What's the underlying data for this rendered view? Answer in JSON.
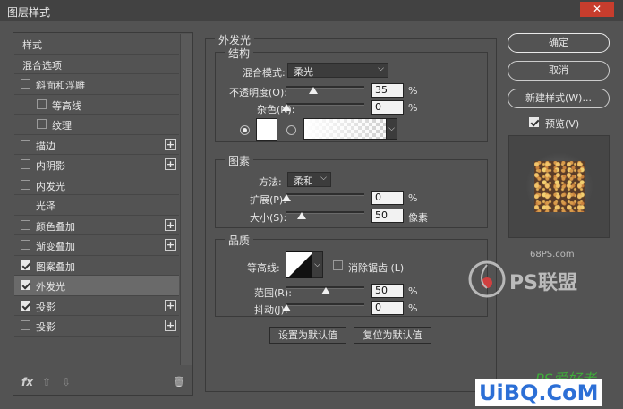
{
  "window": {
    "title": "图层样式",
    "close_label": "✕"
  },
  "left": {
    "items": [
      {
        "label": "样式",
        "checkbox": false,
        "checked": false,
        "indent": 0,
        "plus": false
      },
      {
        "label": "混合选项",
        "checkbox": false,
        "checked": false,
        "indent": 0,
        "plus": false
      },
      {
        "label": "斜面和浮雕",
        "checkbox": true,
        "checked": false,
        "indent": 0,
        "plus": false
      },
      {
        "label": "等高线",
        "checkbox": true,
        "checked": false,
        "indent": 1,
        "plus": false
      },
      {
        "label": "纹理",
        "checkbox": true,
        "checked": false,
        "indent": 1,
        "plus": false
      },
      {
        "label": "描边",
        "checkbox": true,
        "checked": false,
        "indent": 0,
        "plus": true
      },
      {
        "label": "内阴影",
        "checkbox": true,
        "checked": false,
        "indent": 0,
        "plus": true
      },
      {
        "label": "内发光",
        "checkbox": true,
        "checked": false,
        "indent": 0,
        "plus": false
      },
      {
        "label": "光泽",
        "checkbox": true,
        "checked": false,
        "indent": 0,
        "plus": false
      },
      {
        "label": "颜色叠加",
        "checkbox": true,
        "checked": false,
        "indent": 0,
        "plus": true
      },
      {
        "label": "渐变叠加",
        "checkbox": true,
        "checked": false,
        "indent": 0,
        "plus": true
      },
      {
        "label": "图案叠加",
        "checkbox": true,
        "checked": true,
        "indent": 0,
        "plus": false
      },
      {
        "label": "外发光",
        "checkbox": true,
        "checked": true,
        "indent": 0,
        "plus": false,
        "selected": true
      },
      {
        "label": "投影",
        "checkbox": true,
        "checked": true,
        "indent": 0,
        "plus": true
      },
      {
        "label": "投影",
        "checkbox": true,
        "checked": false,
        "indent": 0,
        "plus": true
      }
    ],
    "toolbar": {
      "fx": "fx",
      "up": "⇧",
      "down": "⇩",
      "trash": "🗑"
    }
  },
  "outer_glow": {
    "title": "外发光",
    "structure": {
      "title": "结构",
      "blend_mode_label": "混合模式:",
      "blend_mode_value": "柔光",
      "opacity_label": "不透明度(O):",
      "opacity_value": "35",
      "opacity_unit": "%",
      "noise_label": "杂色(N):",
      "noise_value": "0",
      "noise_unit": "%"
    },
    "elements": {
      "title": "图素",
      "technique_label": "方法:",
      "technique_value": "柔和",
      "spread_label": "扩展(P):",
      "spread_value": "0",
      "spread_unit": "%",
      "size_label": "大小(S):",
      "size_value": "50",
      "size_unit": "像素"
    },
    "quality": {
      "title": "品质",
      "contour_label": "等高线:",
      "antialias_label": "消除锯齿 (L)",
      "range_label": "范围(R):",
      "range_value": "50",
      "range_unit": "%",
      "jitter_label": "抖动(J):",
      "jitter_value": "0",
      "jitter_unit": "%"
    },
    "make_default_label": "设置为默认值",
    "reset_default_label": "复位为默认值"
  },
  "slider_levels": {
    "opacity": 0.35,
    "noise": 0,
    "spread": 0,
    "size": 0.2,
    "range": 0.5,
    "jitter": 0
  },
  "right": {
    "ok_label": "确定",
    "cancel_label": "取消",
    "new_style_label": "新建样式(W)...",
    "preview_label": "预览(V)",
    "preview_checked": true
  },
  "watermarks": {
    "site": "68PS.com",
    "brand": "PS联盟",
    "brand2": "PS爱好者",
    "uibq": "UiBQ.CoM"
  },
  "colors": {
    "panel": "#535353",
    "titlebar": "#424242",
    "close": "#c73d2d",
    "selected": "#6a6a6a",
    "glow_color": "#ffffff"
  }
}
